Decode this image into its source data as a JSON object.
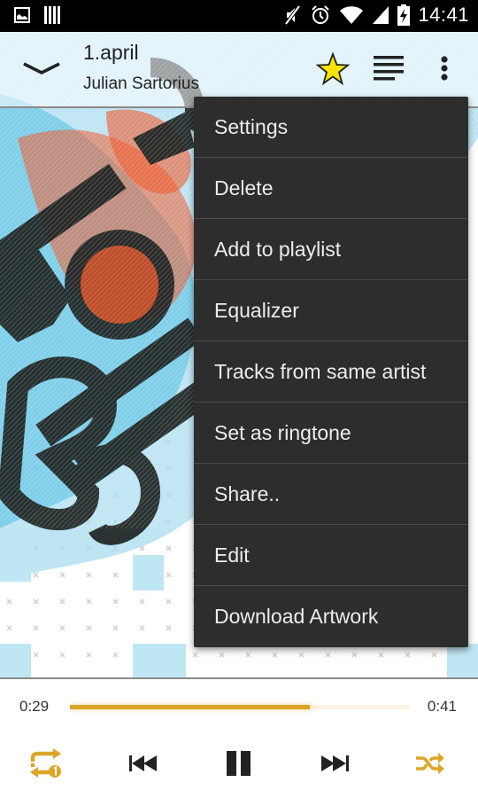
{
  "status_bar": {
    "time": "14:41",
    "left_icons": [
      "image-notification-icon",
      "barcode-notification-icon"
    ],
    "right_icons": [
      "mute-icon",
      "alarm-icon",
      "wifi-icon",
      "cell-signal-icon",
      "battery-charging-icon"
    ]
  },
  "header": {
    "title": "1.april",
    "artist": "Julian Sartorius",
    "favorite": true,
    "icons": [
      "chevron-down-icon",
      "star-icon",
      "queue-list-icon",
      "more-vert-icon"
    ]
  },
  "menu": {
    "items": [
      {
        "label": "Settings"
      },
      {
        "label": "Delete"
      },
      {
        "label": "Add to playlist"
      },
      {
        "label": "Equalizer"
      },
      {
        "label": "Tracks from same artist"
      },
      {
        "label": "Set as ringtone"
      },
      {
        "label": "Share.."
      },
      {
        "label": "Edit"
      },
      {
        "label": "Download Artwork"
      }
    ]
  },
  "player": {
    "current_time": "0:29",
    "total_time": "0:41",
    "progress_fraction": 0.707,
    "repeat_mode": "repeat-one",
    "shuffle": true,
    "playing": true
  },
  "colors": {
    "accent": "#dca527",
    "menu_bg": "#2d2d2d",
    "menu_text": "#ececec",
    "star": "#f5e400",
    "status_bar": "#000000",
    "progress_track": "#fbf3e3",
    "art_orange": "#f0592a",
    "art_blue": "#5ec3e3",
    "art_black": "#1e2322"
  }
}
